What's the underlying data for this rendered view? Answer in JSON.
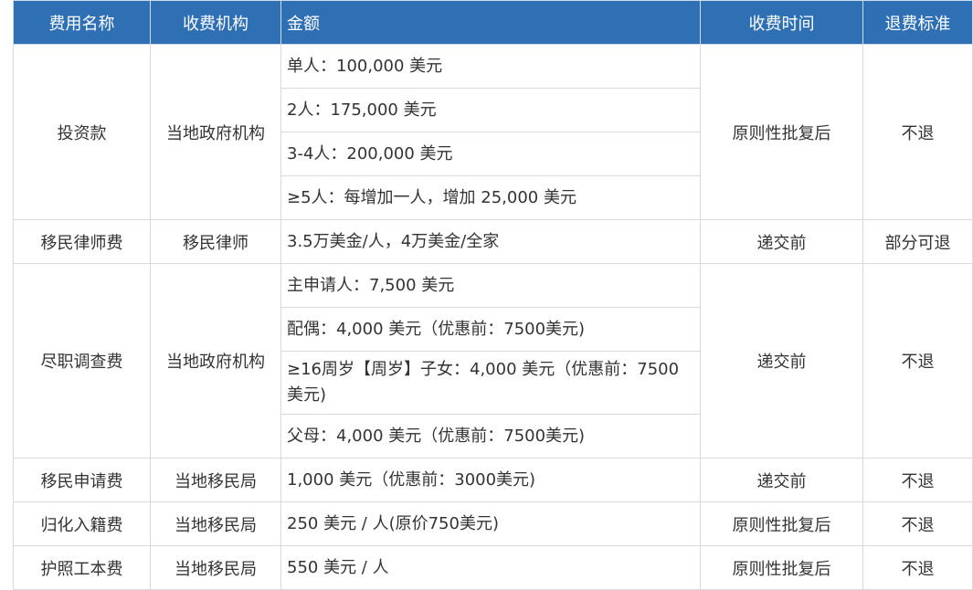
{
  "header": {
    "name": "费用名称",
    "agency": "收费机构",
    "amount": "金额",
    "time": "收费时间",
    "refund": "退费标准"
  },
  "rows": [
    {
      "name": "投资款",
      "agency": "当地政府机构",
      "amounts": [
        "单人：100,000 美元",
        "2人：175,000 美元",
        "3-4人：200,000 美元",
        "≥5人：每增加一人，增加 25,000 美元"
      ],
      "time": "原则性批复后",
      "refund": "不退"
    },
    {
      "name": "移民律师费",
      "agency": "移民律师",
      "amounts": [
        "3.5万美金/人，4万美金/全家"
      ],
      "time": "递交前",
      "refund": "部分可退"
    },
    {
      "name": "尽职调查费",
      "agency": "当地政府机构",
      "amounts": [
        "主申请人：7,500 美元",
        "配偶：4,000 美元（优惠前：7500美元)",
        "≥16周岁【周岁】子女：4,000 美元（优惠前：7500美元)",
        "父母：4,000 美元（优惠前：7500美元)"
      ],
      "time": "递交前",
      "refund": "不退"
    },
    {
      "name": "移民申请费",
      "agency": "当地移民局",
      "amounts": [
        "1,000 美元（优惠前：3000美元)"
      ],
      "time": "递交前",
      "refund": "不退"
    },
    {
      "name": "归化入籍费",
      "agency": "当地移民局",
      "amounts": [
        "250 美元 / 人(原价750美元)"
      ],
      "time": "原则性批复后",
      "refund": "不退"
    },
    {
      "name": "护照工本费",
      "agency": "当地移民局",
      "amounts": [
        "550 美元 / 人"
      ],
      "time": "原则性批复后",
      "refund": "不退"
    }
  ]
}
